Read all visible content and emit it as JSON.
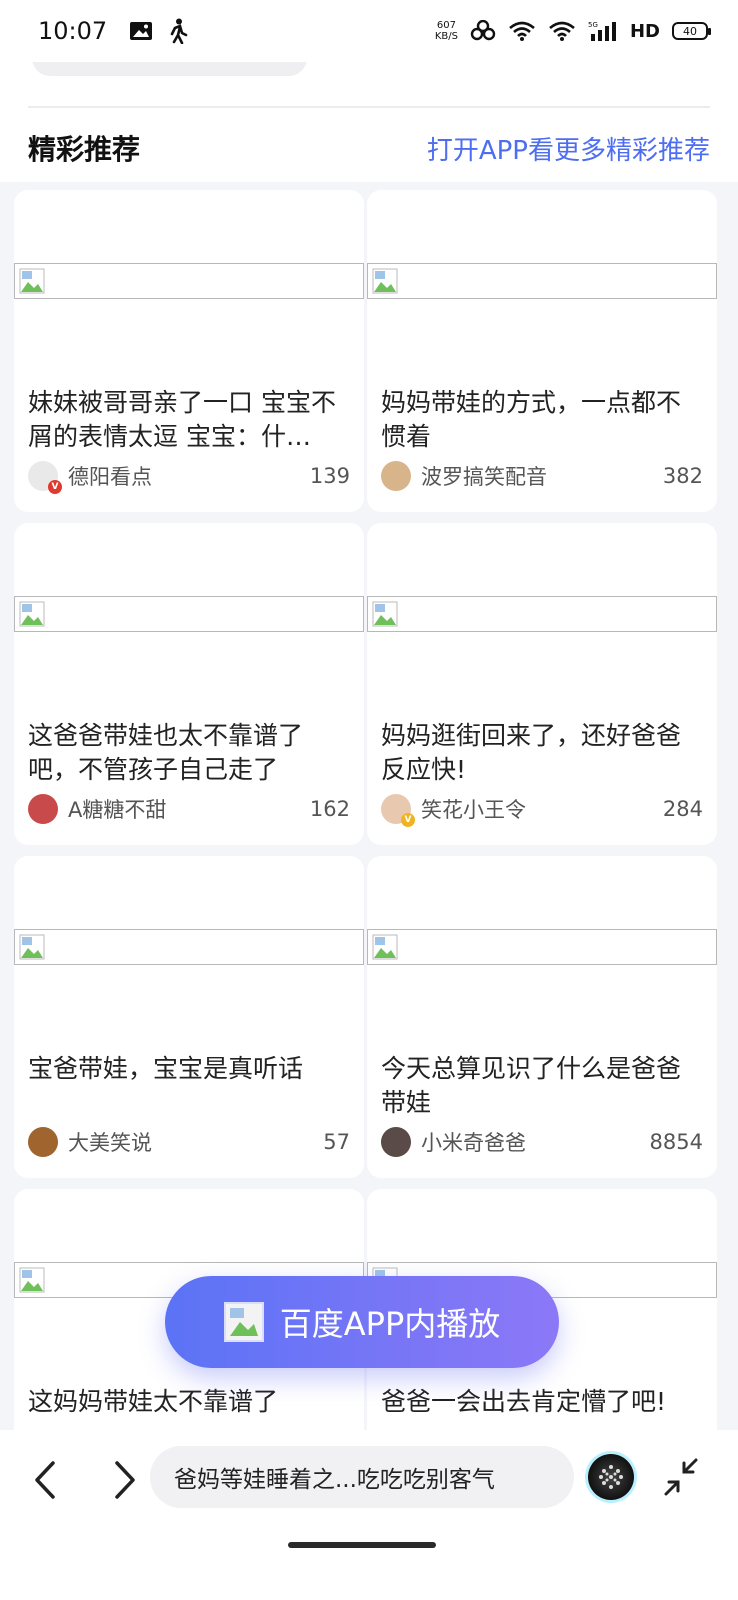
{
  "status": {
    "time": "10:07",
    "speed_value": "607",
    "speed_unit": "KB/S",
    "hd": "HD",
    "battery": "40"
  },
  "section": {
    "title": "精彩推荐",
    "more_link": "打开APP看更多精彩推荐"
  },
  "cards": [
    {
      "title": "妹妹被哥哥亲了一口 宝宝不屑的表情太逗 宝宝：什…",
      "author": "德阳看点",
      "count": "139",
      "avatar_color": "#e9e9e9",
      "badge": "V",
      "badge_color": "#e03a2e"
    },
    {
      "title": "妈妈带娃的方式，一点都不惯着",
      "author": "波罗搞笑配音",
      "count": "382",
      "avatar_color": "#d8b48a",
      "badge": "",
      "badge_color": ""
    },
    {
      "title": "这爸爸带娃也太不靠谱了吧，不管孩子自己走了",
      "author": "A糖糖不甜",
      "count": "162",
      "avatar_color": "#c94a4a",
      "badge": "",
      "badge_color": ""
    },
    {
      "title": "妈妈逛街回来了，还好爸爸反应快!",
      "author": "笑花小王令",
      "count": "284",
      "avatar_color": "#e8c9b0",
      "badge": "V",
      "badge_color": "#f0b323"
    },
    {
      "title": "宝爸带娃，宝宝是真听话",
      "author": "大美笑说",
      "count": "57",
      "avatar_color": "#a0642e",
      "badge": "",
      "badge_color": ""
    },
    {
      "title": "今天总算见识了什么是爸爸带娃",
      "author": "小米奇爸爸",
      "count": "8854",
      "avatar_color": "#5a4a48",
      "badge": "",
      "badge_color": ""
    },
    {
      "title": "这妈妈带娃太不靠谱了",
      "author": "",
      "count": "",
      "avatar_color": "",
      "badge": "",
      "badge_color": ""
    },
    {
      "title": "爸爸一会出去肯定懵了吧!",
      "author": "",
      "count": "",
      "avatar_color": "",
      "badge": "",
      "badge_color": ""
    }
  ],
  "play_button": {
    "label": "百度APP内播放"
  },
  "bottom_bar": {
    "url_text": "爸妈等娃睡着之...吃吃吃别客气"
  },
  "colors": {
    "accent": "#4e6ef2",
    "play_gradient_start": "#5b73f5",
    "play_gradient_end": "#8c78f7"
  }
}
